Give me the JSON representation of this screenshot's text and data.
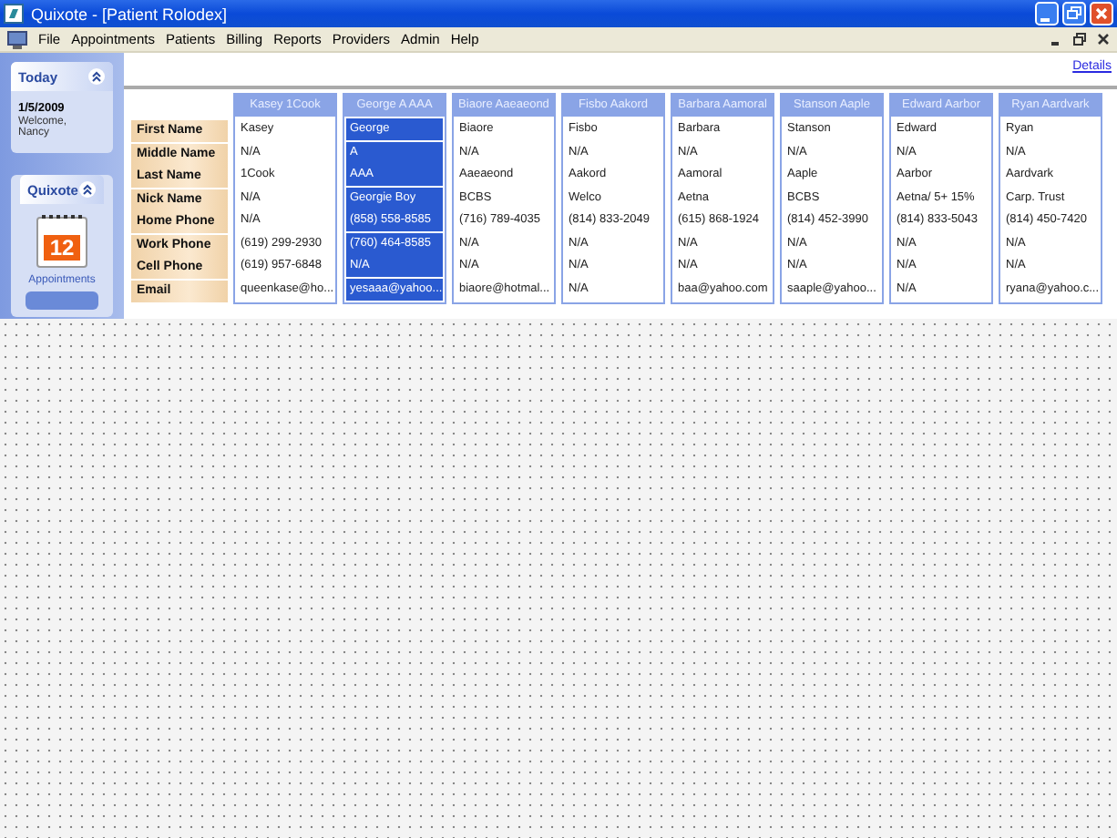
{
  "window": {
    "title": "Quixote - [Patient Rolodex]"
  },
  "menu": [
    "File",
    "Appointments",
    "Patients",
    "Billing",
    "Reports",
    "Providers",
    "Admin",
    "Help"
  ],
  "sidebar": {
    "panels": [
      {
        "kind": "today",
        "title": "Today",
        "date": "1/5/2009",
        "text": "Welcome, Nancy"
      },
      {
        "kind": "launcher",
        "title": "Quixote",
        "icon_text": "12",
        "link": "Appointments"
      }
    ]
  },
  "details_link": "Details",
  "row_labels": [
    "First Name",
    "Middle Name",
    "Last Name",
    "Nick Name",
    "Home Phone",
    "Work Phone",
    "Cell Phone",
    "Email"
  ],
  "patients": [
    {
      "name": "Kasey 1Cook",
      "selected": false,
      "values": [
        "Kasey",
        "N/A",
        "1Cook",
        "N/A",
        "N/A",
        "(619) 299-2930",
        "(619) 957-6848",
        "queenkase@ho..."
      ]
    },
    {
      "name": "George A AAA",
      "selected": true,
      "values": [
        "George",
        "A",
        "AAA",
        "Georgie Boy",
        "(858) 558-8585",
        "(760) 464-8585",
        "N/A",
        "yesaaa@yahoo..."
      ]
    },
    {
      "name": "Biaore Aaeaeond",
      "selected": false,
      "values": [
        "Biaore",
        "N/A",
        "Aaeaeond",
        "BCBS",
        "(716) 789-4035",
        "N/A",
        "N/A",
        "biaore@hotmal..."
      ]
    },
    {
      "name": "Fisbo Aakord",
      "selected": false,
      "values": [
        "Fisbo",
        "N/A",
        "Aakord",
        "Welco",
        "(814) 833-2049",
        "N/A",
        "N/A",
        "N/A"
      ]
    },
    {
      "name": "Barbara Aamoral",
      "selected": false,
      "values": [
        "Barbara",
        "N/A",
        "Aamoral",
        "Aetna",
        "(615) 868-1924",
        "N/A",
        "N/A",
        "baa@yahoo.com"
      ]
    },
    {
      "name": "Stanson Aaple",
      "selected": false,
      "values": [
        "Stanson",
        "N/A",
        "Aaple",
        "BCBS",
        "(814) 452-3990",
        "N/A",
        "N/A",
        "saaple@yahoo..."
      ]
    },
    {
      "name": "Edward Aarbor",
      "selected": false,
      "values": [
        "Edward",
        "N/A",
        "Aarbor",
        "Aetna/ 5+ 15%",
        "(814) 833-5043",
        "N/A",
        "N/A",
        "N/A"
      ]
    },
    {
      "name": "Ryan Aardvark",
      "selected": false,
      "values": [
        "Ryan",
        "N/A",
        "Aardvark",
        "Carp. Trust",
        "(814) 450-7420",
        "N/A",
        "N/A",
        "ryana@yahoo.c..."
      ]
    }
  ]
}
